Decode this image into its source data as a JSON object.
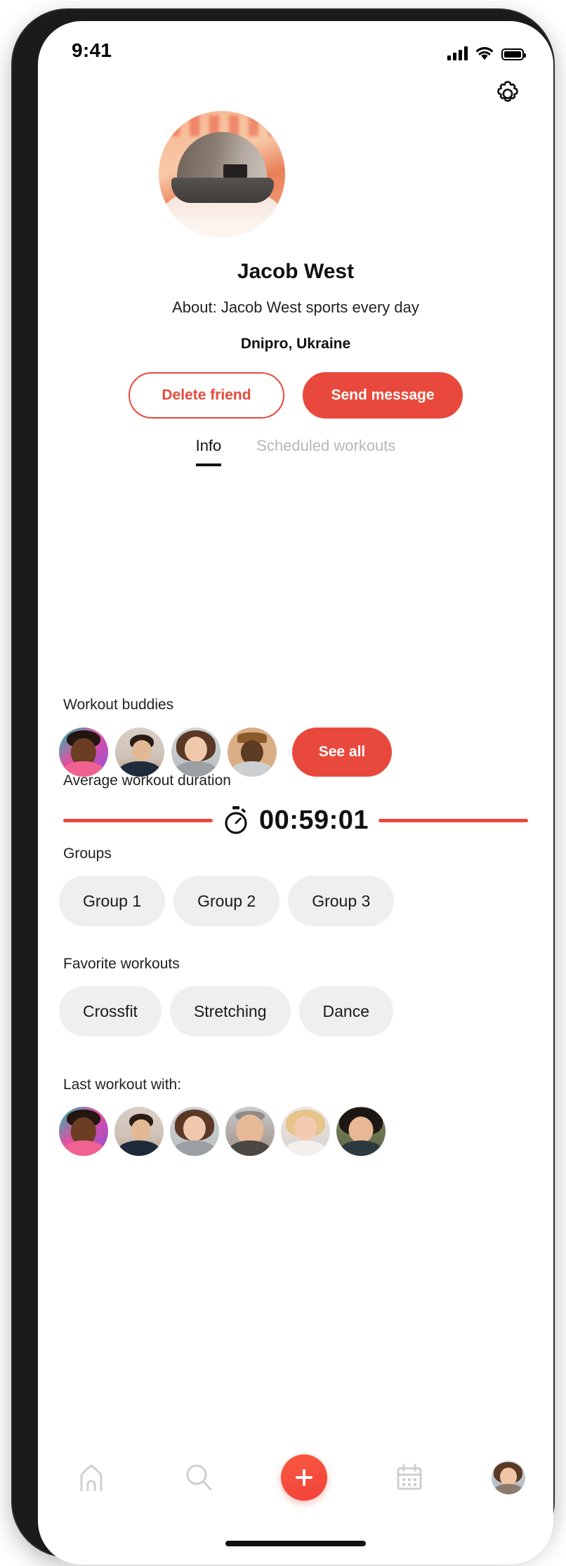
{
  "status_bar": {
    "time": "9:41",
    "signal_icon": "cellular-signal-icon",
    "wifi_icon": "wifi-icon",
    "battery_icon": "battery-full-icon"
  },
  "header": {
    "settings_icon": "gear-icon"
  },
  "profile": {
    "avatar": "profile-avatar-photo",
    "name": "Jacob West",
    "about": "About: Jacob West sports every day",
    "location": "Dnipro, Ukraine"
  },
  "actions": {
    "delete_friend_label": "Delete friend",
    "send_message_label": "Send message"
  },
  "tabs": [
    {
      "label": "Info",
      "active": true
    },
    {
      "label": "Scheduled workouts",
      "active": false
    }
  ],
  "workout_buddies": {
    "title": "Workout buddies",
    "see_all_label": "See all",
    "avatars": [
      "buddy-avatar-1",
      "buddy-avatar-2",
      "buddy-avatar-3",
      "buddy-avatar-4"
    ]
  },
  "average_duration": {
    "title": "Average workout duration",
    "icon": "stopwatch-icon",
    "value": "00:59:01"
  },
  "groups": {
    "title": "Groups",
    "items": [
      "Group 1",
      "Group 2",
      "Group 3"
    ]
  },
  "favorite_workouts": {
    "title": "Favorite workouts",
    "items": [
      "Crossfit",
      "Stretching",
      "Dance"
    ]
  },
  "last_workout": {
    "title": "Last workout with:",
    "avatars": [
      "last-workout-avatar-1",
      "last-workout-avatar-2",
      "last-workout-avatar-3",
      "last-workout-avatar-4",
      "last-workout-avatar-5",
      "last-workout-avatar-6"
    ]
  },
  "bottom_nav": {
    "items": [
      {
        "name": "home-icon"
      },
      {
        "name": "search-icon"
      },
      {
        "name": "add-icon"
      },
      {
        "name": "calendar-icon"
      },
      {
        "name": "profile-avatar-icon"
      }
    ]
  },
  "colors": {
    "accent_red": "#E8493C",
    "chip_gray": "#EFEFEF",
    "inactive_gray": "#B7B7B7",
    "text_dark": "#111111"
  }
}
